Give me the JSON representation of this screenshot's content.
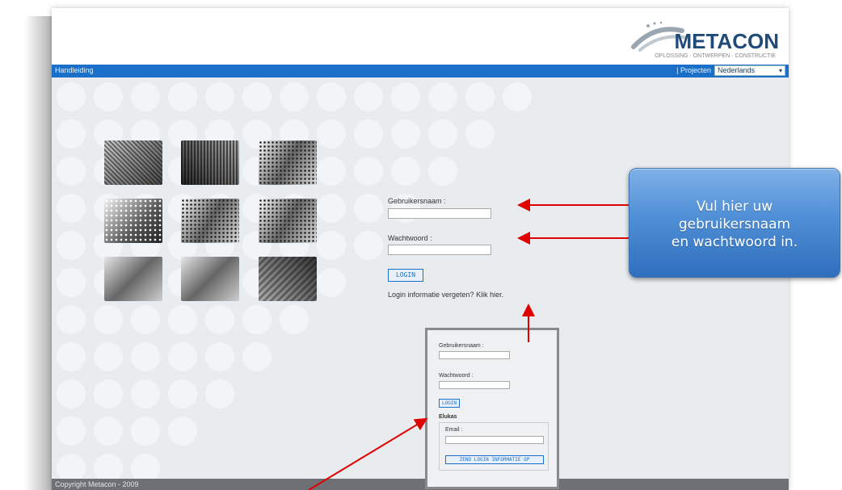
{
  "header": {
    "brand": "METACON",
    "tagline": "OPLOSSING · ONTWERPEN · CONSTRUCTIE"
  },
  "navbar": {
    "help_link": "Handleiding",
    "projects_link": "| Projecten",
    "language_selected": "Nederlands"
  },
  "login": {
    "username_label": "Gebruikersnaam :",
    "username_value": "",
    "password_label": "Wachtwoord :",
    "password_value": "",
    "login_button": "LOGIN",
    "forgot_text": "Login informatie vergeten? Klik hier."
  },
  "inset": {
    "username_label": "Gebruikersnaam :",
    "password_label": "Wachtwoord :",
    "login_button": "LOGIN",
    "section_title": "Elukas",
    "email_label": "Email :",
    "send_button": "ZEND LOGIN INFORMATIE OP"
  },
  "callout": {
    "text": "Vul hier uw\ngebruikersnaam\nen wachtwoord in."
  },
  "footer": {
    "copyright": "Copyright Metacon - 2009"
  },
  "colors": {
    "nav_blue": "#1a70c9",
    "content_bg": "#e9ecef",
    "footer_gray": "#6e7075",
    "arrow_red": "#e00000",
    "brand_navy": "#1f4b7a"
  }
}
